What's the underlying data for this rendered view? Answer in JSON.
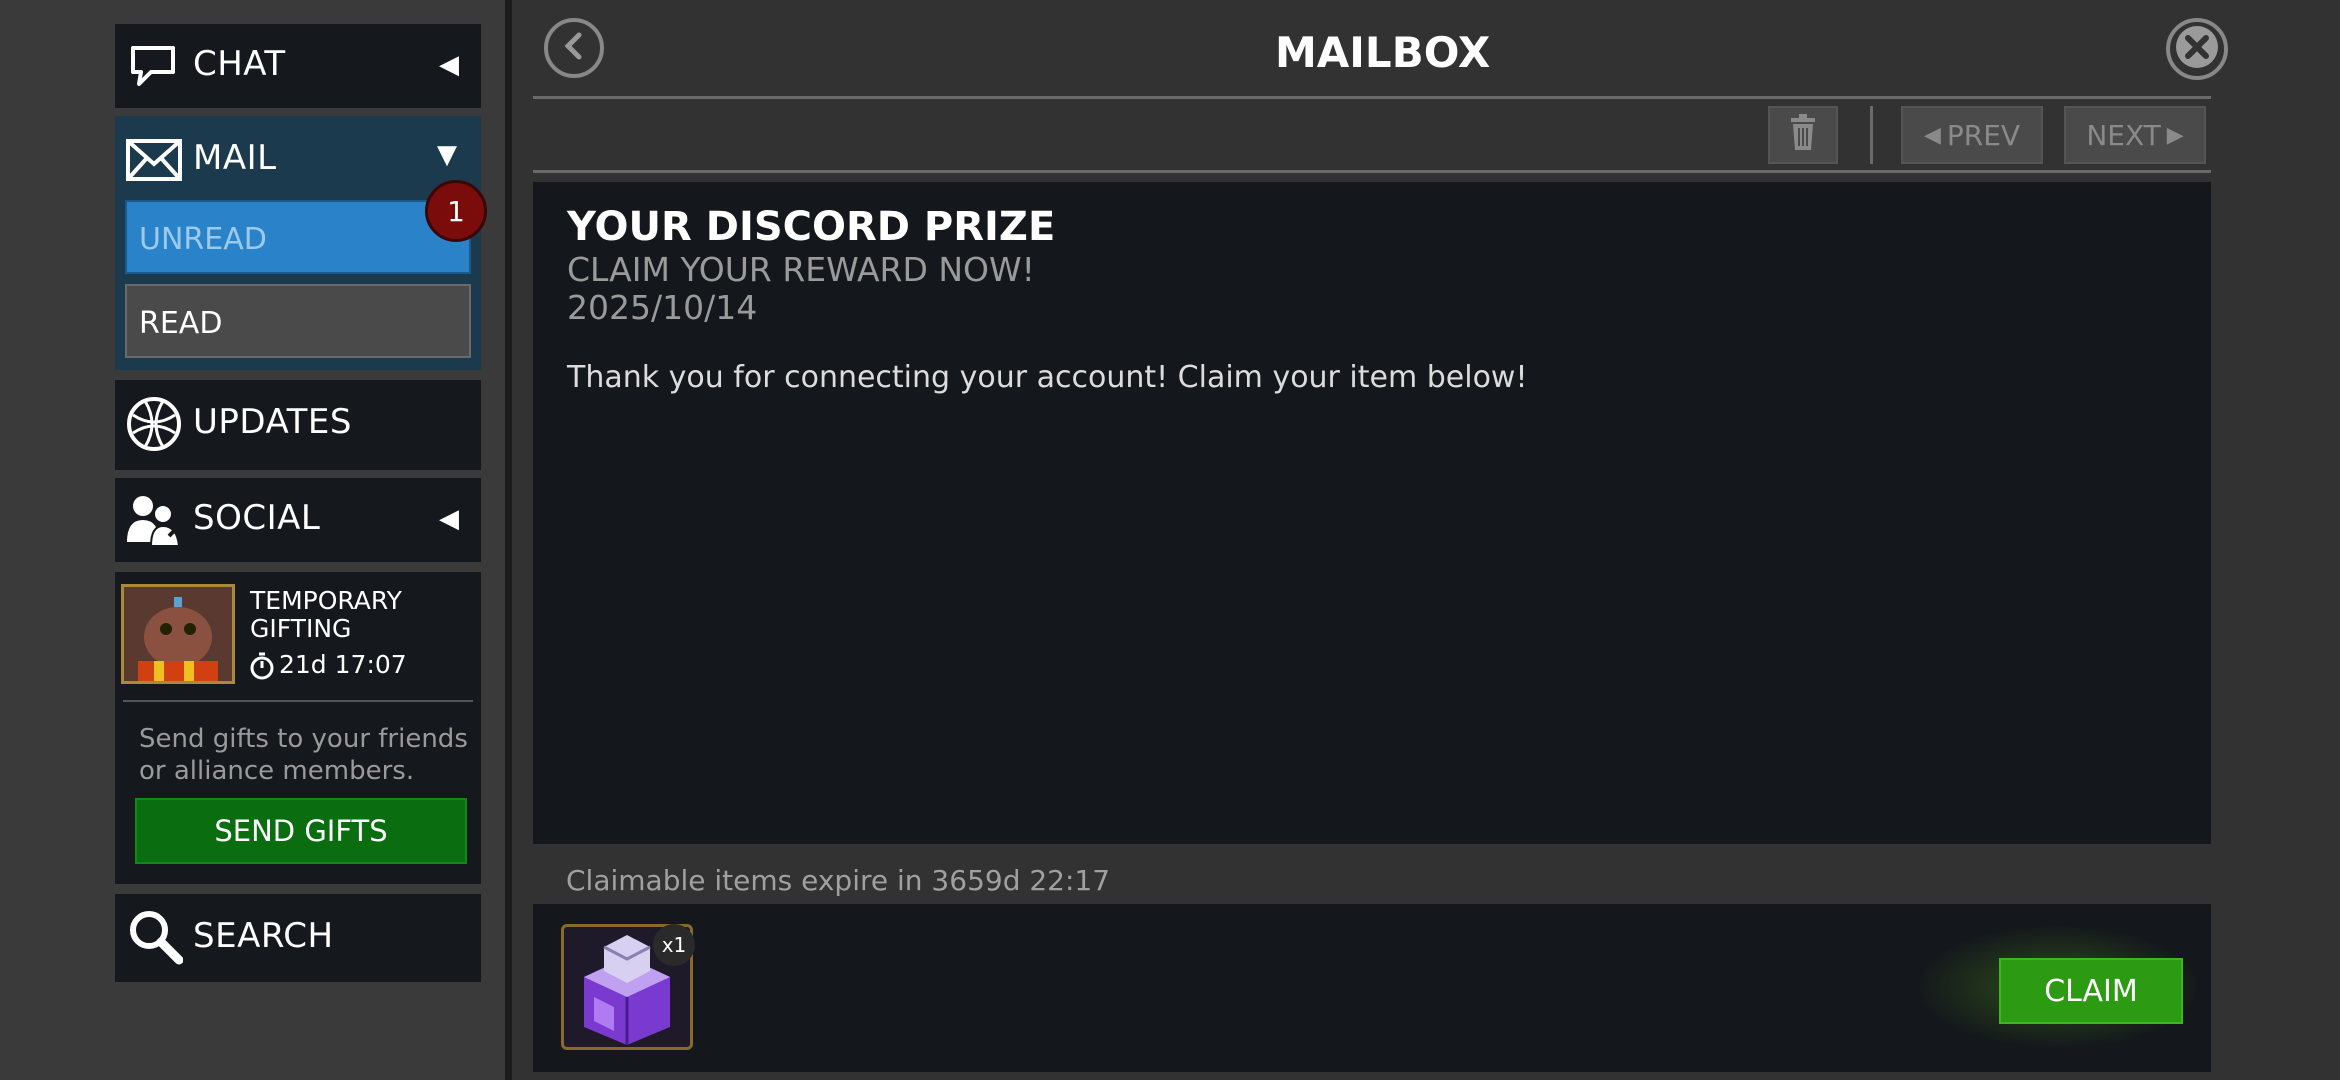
{
  "sidebar": {
    "chat": {
      "label": "CHAT",
      "icon": "chat-bubble-icon",
      "arrow": "◀"
    },
    "mail": {
      "label": "MAIL",
      "icon": "envelope-icon",
      "arrow": "▼",
      "badge": "1",
      "unread": "UNREAD",
      "read": "READ"
    },
    "updates": {
      "label": "UPDATES",
      "icon": "globe-icon"
    },
    "social": {
      "label": "SOCIAL",
      "icon": "people-icon",
      "arrow": "◀"
    },
    "gifting": {
      "title_line1": "TEMPORARY",
      "title_line2": "GIFTING",
      "timer": "21d 17:07",
      "desc_line1": "Send gifts to your friends",
      "desc_line2": "or alliance members.",
      "button": "SEND GIFTS"
    },
    "search": {
      "label": "SEARCH",
      "icon": "magnifier-icon"
    }
  },
  "header": {
    "title": "MAILBOX"
  },
  "toolbar": {
    "prev": "PREV",
    "next": "NEXT"
  },
  "message": {
    "title": "YOUR DISCORD PRIZE",
    "subtitle": "CLAIM YOUR REWARD NOW!",
    "date": "2025/10/14",
    "body": "Thank you for connecting your account! Claim your item below!"
  },
  "rewards": {
    "expiry": "Claimable items expire in 3659d 22:17",
    "item_count": "x1",
    "claim": "CLAIM"
  },
  "colors": {
    "unread_blue": "#2a82c8",
    "send_gifts_green": "#0a6e10",
    "claim_green": "#2d9a14",
    "badge_red": "#7a0c0c"
  }
}
